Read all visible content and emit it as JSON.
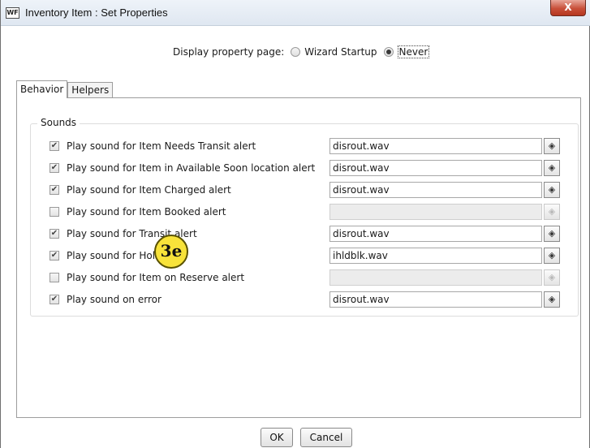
{
  "window": {
    "app_icon_text": "WF",
    "title": "Inventory Item : Set Properties",
    "close_glyph": "X"
  },
  "display_property": {
    "label": "Display property page:",
    "options": [
      {
        "label": "Wizard Startup",
        "selected": false
      },
      {
        "label": "Never",
        "selected": true
      }
    ]
  },
  "tabs": [
    {
      "label": "Behavior",
      "active": true
    },
    {
      "label": "Helpers",
      "active": false
    }
  ],
  "sounds": {
    "group_label": "Sounds",
    "rows": [
      {
        "label": "Play sound for Item Needs Transit alert",
        "checked": true,
        "file": "disrout.wav",
        "enabled": true
      },
      {
        "label": "Play sound for Item in Available Soon location alert",
        "checked": true,
        "file": "disrout.wav",
        "enabled": true
      },
      {
        "label": "Play sound for Item Charged alert",
        "checked": true,
        "file": "disrout.wav",
        "enabled": true
      },
      {
        "label": "Play sound for Item Booked alert",
        "checked": false,
        "file": "",
        "enabled": false
      },
      {
        "label": "Play sound for Transit alert",
        "checked": true,
        "file": "disrout.wav",
        "enabled": true
      },
      {
        "label": "Play sound for Hold alert",
        "checked": true,
        "file": "ihldblk.wav",
        "enabled": true
      },
      {
        "label": "Play sound for Item on Reserve alert",
        "checked": false,
        "file": "",
        "enabled": false
      },
      {
        "label": "Play sound on error",
        "checked": true,
        "file": "disrout.wav",
        "enabled": true
      }
    ],
    "browse_icon": "diamond-arrows-icon"
  },
  "callout": {
    "text": "3e",
    "color": "#f8e33a"
  },
  "buttons": {
    "ok": "OK",
    "cancel": "Cancel"
  }
}
